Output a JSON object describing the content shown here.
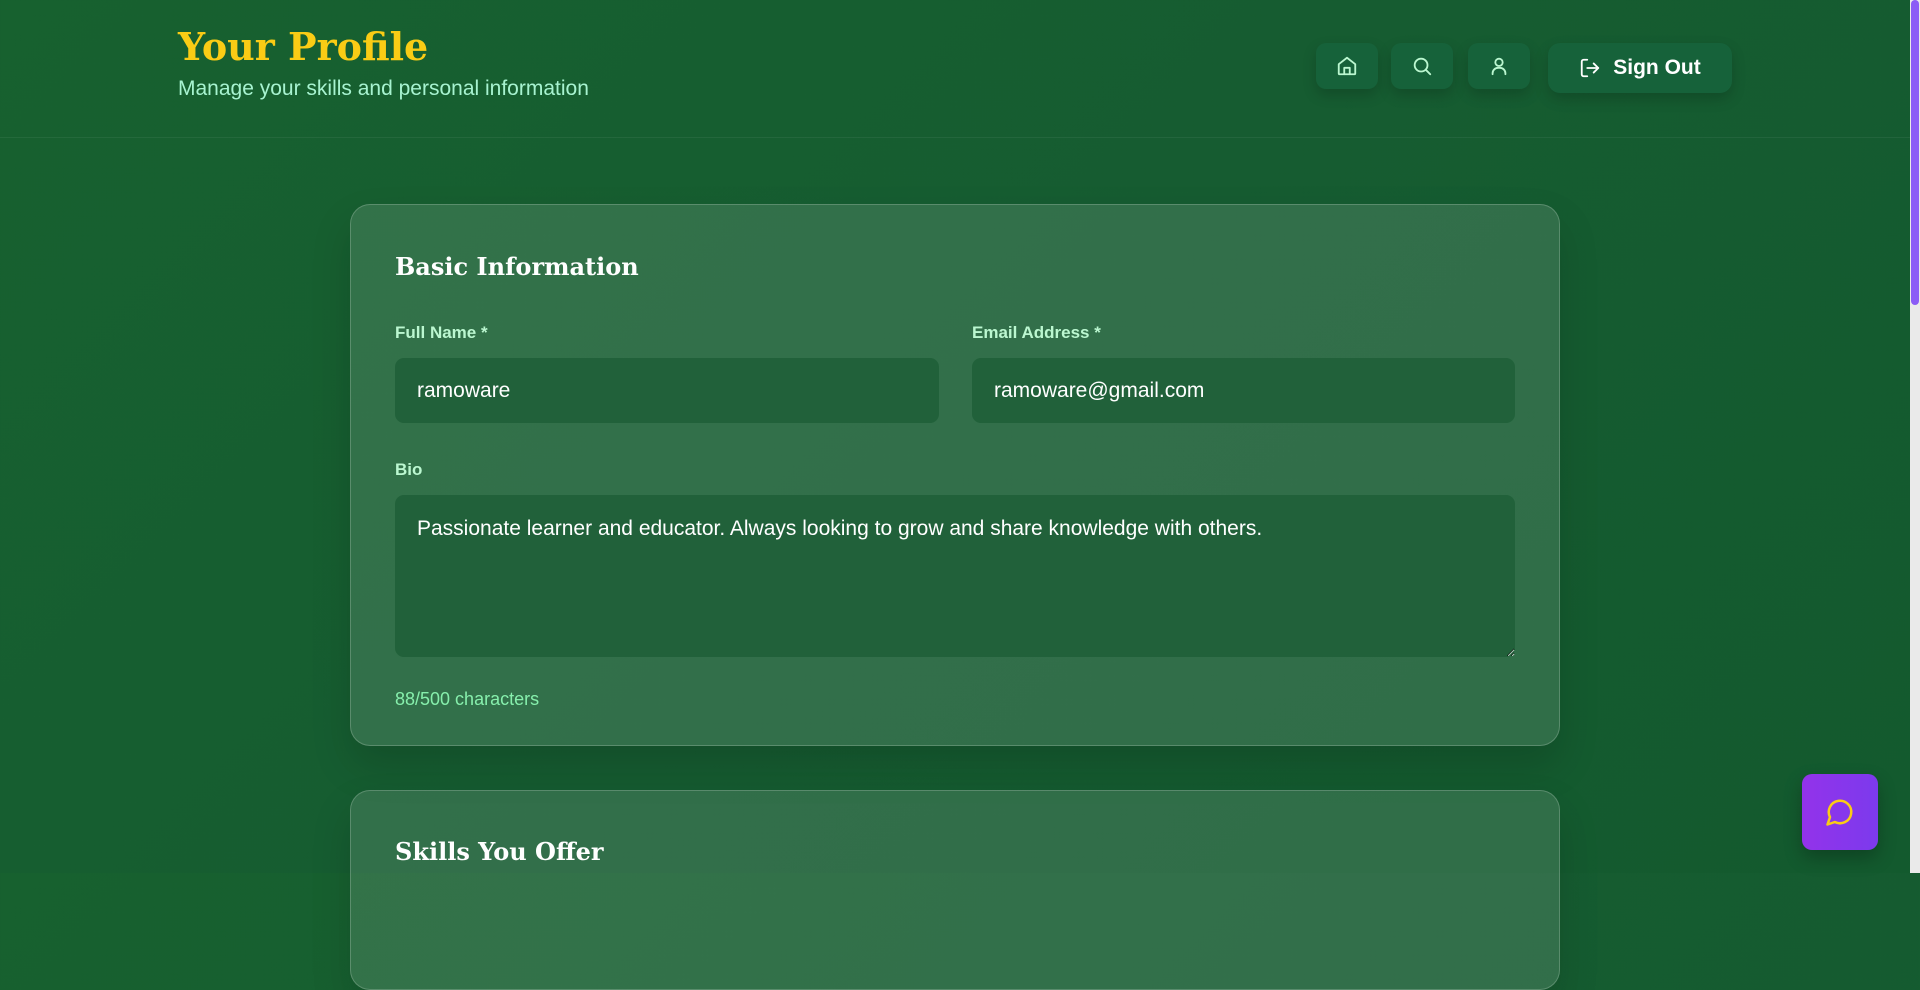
{
  "header": {
    "title": "Your Profile",
    "subtitle": "Manage your skills and personal information",
    "sign_out_label": "Sign Out"
  },
  "nav_icons": [
    "home-icon",
    "search-icon",
    "user-icon",
    "sign-out-icon"
  ],
  "basic_info": {
    "title": "Basic Information",
    "full_name_label": "Full Name *",
    "full_name_value": "ramoware",
    "email_label": "Email Address *",
    "email_value": "ramoware@gmail.com",
    "bio_label": "Bio",
    "bio_value": "Passionate learner and educator. Always looking to grow and share knowledge with others.",
    "counter": "88/500 characters"
  },
  "skills": {
    "title": "Skills You Offer"
  },
  "colors": {
    "accent": "#facc15",
    "chat_button": "#9333ea",
    "background": "#165c31"
  }
}
